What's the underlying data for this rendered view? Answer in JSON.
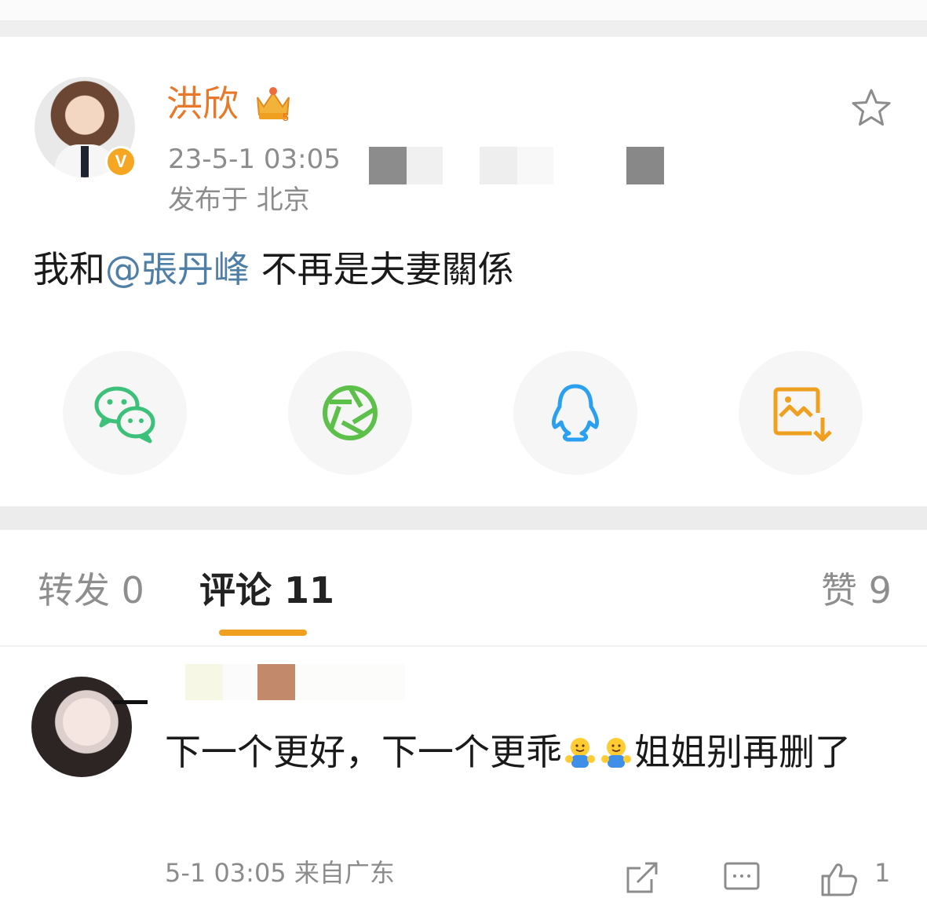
{
  "post": {
    "author": "洪欣",
    "time": "23-5-1 03:05",
    "location": "发布于 北京",
    "text_before": "我和",
    "mention": "@張丹峰",
    "text_after": " 不再是夫妻關係",
    "verified_badge": "V"
  },
  "share_icons": [
    "wechat-icon",
    "moments-icon",
    "qq-icon",
    "save-image-icon"
  ],
  "tabs": {
    "repost": "转发 0",
    "comments": "评论 11",
    "likes": "赞 9"
  },
  "comment": {
    "text": "下一个更好，下一个更乖",
    "text_end": "姐姐别再删了",
    "meta": "5-1 03:05 来自广东",
    "like_count": "1"
  },
  "colors": {
    "author": "#e8782a",
    "mention": "#4f7ea6",
    "tab_underline": "#f0a020",
    "verified": "#f5a623"
  }
}
